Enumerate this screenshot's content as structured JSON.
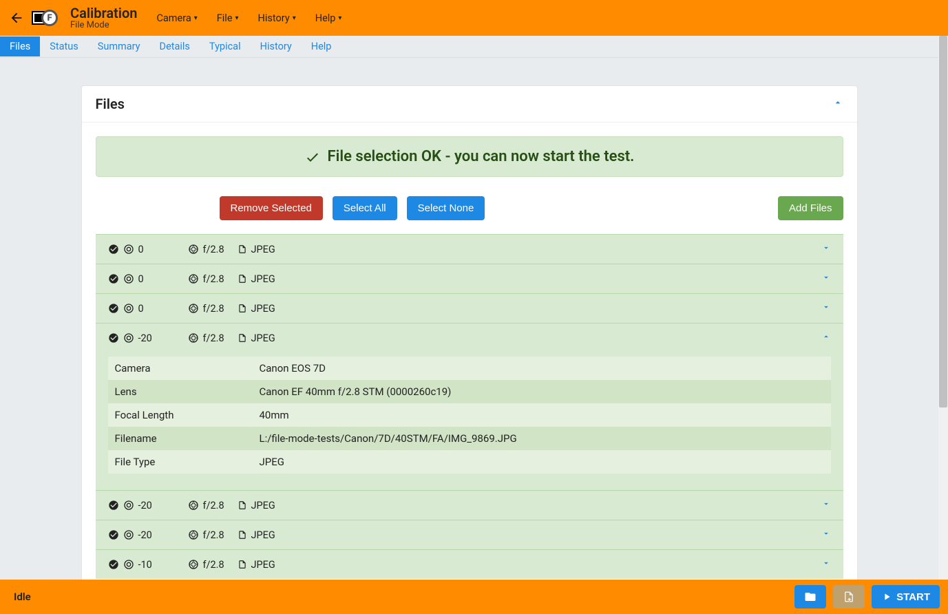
{
  "header": {
    "title": "Calibration",
    "subtitle": "File Mode",
    "menu": [
      "Camera",
      "File",
      "History",
      "Help"
    ]
  },
  "tabs": [
    "Files",
    "Status",
    "Summary",
    "Details",
    "Typical",
    "History",
    "Help"
  ],
  "activeTab": 0,
  "panel": {
    "title": "Files",
    "alert": "File selection OK - you can now start the test.",
    "buttons": {
      "remove": "Remove Selected",
      "selectAll": "Select All",
      "selectNone": "Select None",
      "addFiles": "Add Files"
    },
    "files": [
      {
        "offset": "0",
        "aperture": "f/2.8",
        "type": "JPEG",
        "expanded": false
      },
      {
        "offset": "0",
        "aperture": "f/2.8",
        "type": "JPEG",
        "expanded": false
      },
      {
        "offset": "0",
        "aperture": "f/2.8",
        "type": "JPEG",
        "expanded": false
      },
      {
        "offset": "-20",
        "aperture": "f/2.8",
        "type": "JPEG",
        "expanded": true,
        "details": {
          "Camera": "Canon EOS 7D",
          "Lens": "Canon EF 40mm f/2.8 STM (0000260c19)",
          "Focal Length": "40mm",
          "Filename": "L:/file-mode-tests/Canon/7D/40STM/FA/IMG_9869.JPG",
          "File Type": "JPEG"
        }
      },
      {
        "offset": "-20",
        "aperture": "f/2.8",
        "type": "JPEG",
        "expanded": false
      },
      {
        "offset": "-20",
        "aperture": "f/2.8",
        "type": "JPEG",
        "expanded": false
      },
      {
        "offset": "-10",
        "aperture": "f/2.8",
        "type": "JPEG",
        "expanded": false
      }
    ],
    "detailLabels": {
      "camera": "Camera",
      "lens": "Lens",
      "focal": "Focal Length",
      "filename": "Filename",
      "filetype": "File Type"
    }
  },
  "footer": {
    "status": "Idle",
    "start": "START"
  }
}
